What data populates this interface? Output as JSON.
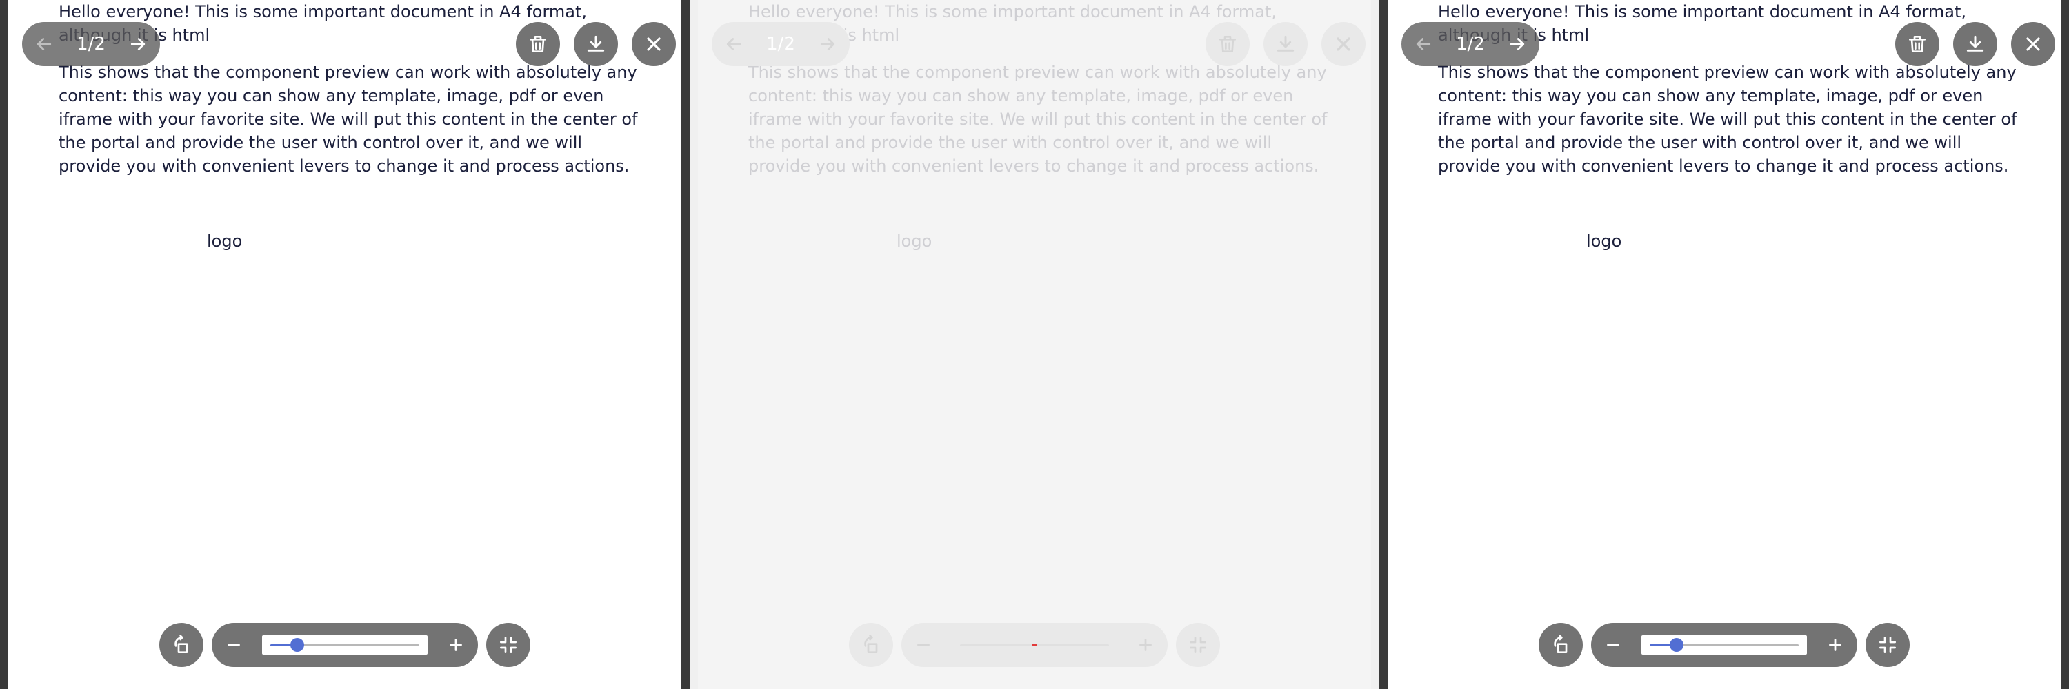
{
  "viewers": [
    {
      "state": "enabled",
      "doc": {
        "p1": "Hello everyone! This is some important document in A4 format, although it is html",
        "p2": "This shows that the component preview can work with absolutely any content: this way you can show any template, image, pdf or even iframe with your favorite site. We will put this content in the center of the portal and provide the user with control over it, and we will provide you with convenient levers to change it and process actions.",
        "logo_alt": "logo"
      },
      "pager": {
        "counter": "1/2"
      },
      "zoom": {
        "level": 0.18
      }
    },
    {
      "state": "disabled",
      "doc": {
        "p1": "Hello everyone! This is some important document in A4 format, although it is html",
        "p2": "This shows that the component preview can work with absolutely any content: this way you can show any template, image, pdf or even iframe with your favorite site. We will put this content in the center of the portal and provide the user with control over it, and we will provide you with convenient levers to change it and process actions.",
        "logo_alt": "logo"
      },
      "pager": {
        "counter": "1/2"
      },
      "zoom": {
        "level": 0.5
      }
    },
    {
      "state": "enabled",
      "doc": {
        "p1": "Hello everyone! This is some important document in A4 format, although it is html",
        "p2": "This shows that the component preview can work with absolutely any content: this way you can show any template, image, pdf or even iframe with your favorite site. We will put this content in the center of the portal and provide the user with control over it, and we will provide you with convenient levers to change it and process actions.",
        "logo_alt": "logo"
      },
      "pager": {
        "counter": "1/2"
      },
      "zoom": {
        "level": 0.18
      }
    }
  ],
  "icons": {
    "prev": "arrow-left-icon",
    "next": "arrow-right-icon",
    "delete": "trash-icon",
    "download": "download-icon",
    "close": "close-icon",
    "rotate": "rotate-icon",
    "zoom_out": "minus-icon",
    "zoom_in": "plus-icon",
    "fit": "minimize-icon"
  },
  "colors": {
    "accent": "#526ed3",
    "control_bg": "#5a5a5a",
    "text": "#1b1f3b",
    "disabled_marker": "#e23b3b"
  }
}
